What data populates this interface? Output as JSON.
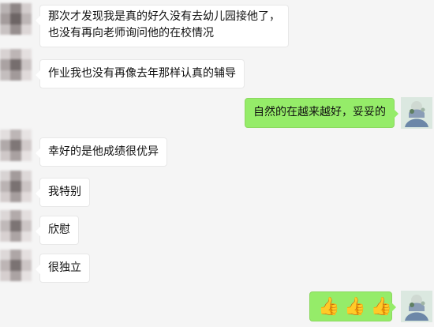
{
  "conversation": {
    "messages": [
      {
        "side": "left",
        "lines": [
          "那次才发现我是真的好久没有去幼儿园接他了，",
          "也没有再向老师询问他的在校情况"
        ]
      },
      {
        "side": "left",
        "lines": [
          "作业我也没有再像去年那样认真的辅导"
        ]
      },
      {
        "side": "right",
        "lines": [
          "自然的在越来越好，妥妥的"
        ]
      },
      {
        "side": "left",
        "lines": [
          "幸好的是他成绩很优异"
        ]
      },
      {
        "side": "left",
        "lines": [
          "我特别"
        ]
      },
      {
        "side": "left",
        "lines": [
          "欣慰"
        ]
      },
      {
        "side": "left",
        "lines": [
          "很独立"
        ]
      },
      {
        "side": "right",
        "emoji": [
          "👍",
          "👍",
          "👍"
        ]
      }
    ]
  },
  "colors": {
    "background": "#f5f5f5",
    "left_bubble": "#ffffff",
    "right_bubble": "#95ec69",
    "text": "#111111"
  },
  "icons": {
    "thumbs_up": "thumbs-up-icon"
  }
}
